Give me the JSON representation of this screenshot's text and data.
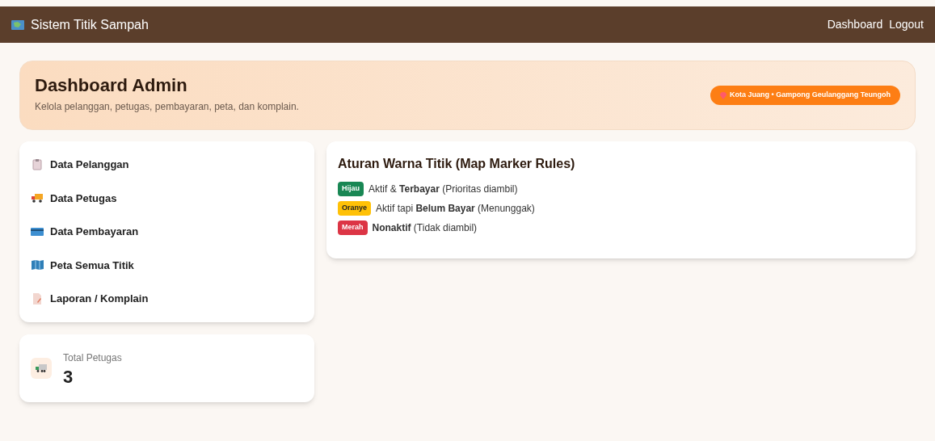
{
  "navbar": {
    "title": "Sistem Titik Sampah",
    "links": [
      "Dashboard",
      "Logout"
    ]
  },
  "header": {
    "title": "Dashboard Admin",
    "subtitle": "Kelola pelanggan, petugas, pembayaran, peta, dan komplain.",
    "location": "Kota Juang • Gampong Geulanggang Teungoh"
  },
  "menu": [
    {
      "label": "Data Pelanggan",
      "kind": "clipboard"
    },
    {
      "label": "Data Petugas",
      "kind": "truck"
    },
    {
      "label": "Data Pembayaran",
      "kind": "card"
    },
    {
      "label": "Peta Semua Titik",
      "kind": "map"
    },
    {
      "label": "Laporan / Komplain",
      "kind": "memo"
    }
  ],
  "stat": {
    "label": "Total Petugas",
    "value": "3"
  },
  "rules": {
    "title": "Aturan Warna Titik (Map Marker Rules)",
    "items": [
      {
        "badge": "Hijau",
        "color": "#198754",
        "text": "Aktif & **Terbayar** (Prioritas diambil)"
      },
      {
        "badge": "Oranye",
        "color": "#ffc107",
        "text": "Aktif tapi **Belum Bayar** (Menunggak)"
      },
      {
        "badge": "Merah",
        "color": "#dc3545",
        "text": "**Nonaktif** (Tidak diambil)"
      }
    ]
  }
}
